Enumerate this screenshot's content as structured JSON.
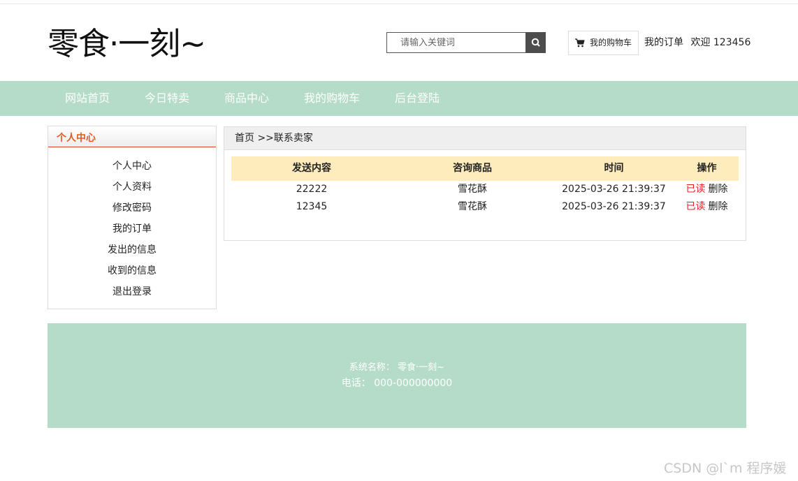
{
  "header": {
    "logo": "零食·一刻~",
    "search": {
      "placeholder": "请输入关键词",
      "value": ""
    },
    "cart_label": "我的购物车",
    "orders_link": "我的订单",
    "welcome": "欢迎 123456"
  },
  "nav": {
    "items": [
      "网站首页",
      "今日特卖",
      "商品中心",
      "我的购物车",
      "后台登陆"
    ]
  },
  "sidebar": {
    "title": "个人中心",
    "items": [
      "个人中心",
      "个人资料",
      "修改密码",
      "我的订单",
      "发出的信息",
      "收到的信息",
      "退出登录"
    ]
  },
  "main": {
    "breadcrumb": "首页 >>联系卖家",
    "table": {
      "headers": [
        "发送内容",
        "咨询商品",
        "时间",
        "操作"
      ],
      "rows": [
        {
          "content": "22222",
          "product": "雪花酥",
          "time": "2025-03-26 21:39:37",
          "read": "已读",
          "delete": "删除"
        },
        {
          "content": "12345",
          "product": "雪花酥",
          "time": "2025-03-26 21:39:37",
          "read": "已读",
          "delete": "删除"
        }
      ]
    }
  },
  "footer": {
    "system_name": "系统名称：  零食·一刻~",
    "phone": "电话：  000-000000000"
  },
  "watermark": "CSDN @l`m 程序媛",
  "colors": {
    "nav_bg": "#b5dcc8",
    "table_header_bg": "#ffecbd",
    "accent_orange": "#e25a20",
    "link_red": "#e02020"
  },
  "icons": {
    "search_button": "search-icon",
    "cart": "cart-icon"
  }
}
